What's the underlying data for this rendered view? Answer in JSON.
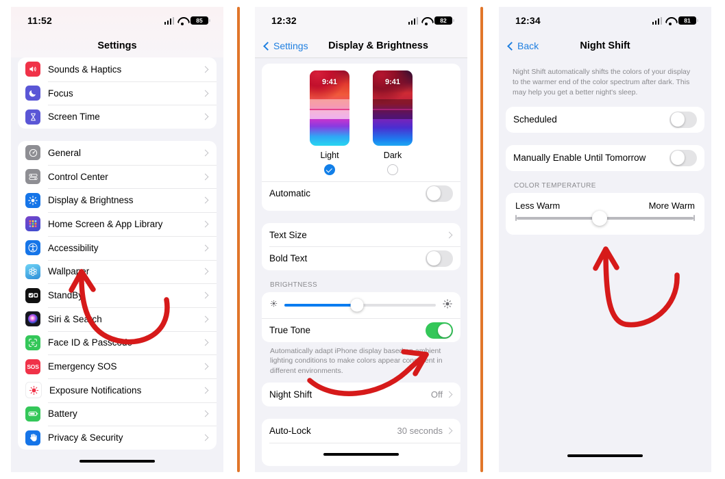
{
  "page": {
    "background": "#ffffff",
    "divider_color": "#e1762a"
  },
  "panels": [
    {
      "id": "settings-list",
      "status": {
        "time": "11:52",
        "battery": "85"
      },
      "nav": {
        "title": "Settings"
      },
      "groups": [
        {
          "rows": [
            {
              "label": "Sounds & Haptics",
              "icon": "speaker-icon",
              "icon_color": "#f03248",
              "accessory": "chevron"
            },
            {
              "label": "Focus",
              "icon": "moon-icon",
              "icon_color": "#5a56d6",
              "accessory": "chevron"
            },
            {
              "label": "Screen Time",
              "icon": "hourglass-icon",
              "icon_color": "#5a56d6",
              "accessory": "chevron"
            }
          ]
        },
        {
          "rows": [
            {
              "label": "General",
              "icon": "gear-icon",
              "icon_color": "#8e8e93",
              "accessory": "chevron"
            },
            {
              "label": "Control Center",
              "icon": "sliders-icon",
              "icon_color": "#8e8e93",
              "accessory": "chevron"
            },
            {
              "label": "Display & Brightness",
              "icon": "brightness-icon",
              "icon_color": "#1675e8",
              "accessory": "chevron"
            },
            {
              "label": "Home Screen & App Library",
              "icon": "app-grid-icon",
              "icon_color": "#5b3fb5",
              "accessory": "chevron"
            },
            {
              "label": "Accessibility",
              "icon": "accessibility-icon",
              "icon_color": "#1675e8",
              "accessory": "chevron"
            },
            {
              "label": "Wallpaper",
              "icon": "flower-icon",
              "icon_color": "#37b0e8",
              "accessory": "chevron"
            },
            {
              "label": "StandBy",
              "icon": "standby-icon",
              "icon_color": "#111111",
              "accessory": "chevron"
            },
            {
              "label": "Siri & Search",
              "icon": "siri-icon",
              "icon_color": "#1d1d2b",
              "accessory": "chevron"
            },
            {
              "label": "Face ID & Passcode",
              "icon": "faceid-icon",
              "icon_color": "#34c759",
              "accessory": "chevron"
            },
            {
              "label": "Emergency SOS",
              "icon": "sos-icon",
              "icon_color": "#f03248",
              "accessory": "chevron"
            },
            {
              "label": "Exposure Notifications",
              "icon": "exposure-icon",
              "icon_color": "#ffffff",
              "accessory": "chevron"
            },
            {
              "label": "Battery",
              "icon": "battery-icon",
              "icon_color": "#34c759",
              "accessory": "chevron"
            },
            {
              "label": "Privacy & Security",
              "icon": "hand-icon",
              "icon_color": "#1675e8",
              "accessory": "chevron"
            }
          ]
        }
      ]
    },
    {
      "id": "display-brightness",
      "status": {
        "time": "12:32",
        "battery": "82"
      },
      "nav": {
        "back_label": "Settings",
        "title": "Display & Brightness"
      },
      "appearance": {
        "options": [
          {
            "label": "Light",
            "selected": true,
            "wallpaper_time": "9:41"
          },
          {
            "label": "Dark",
            "selected": false,
            "wallpaper_time": "9:41"
          }
        ],
        "automatic": {
          "label": "Automatic",
          "on": false
        }
      },
      "text_group": [
        {
          "label": "Text Size",
          "accessory": "chevron"
        },
        {
          "label": "Bold Text",
          "accessory": "toggle",
          "on": false
        }
      ],
      "brightness": {
        "header": "BRIGHTNESS",
        "slider_percent": 48,
        "low_icon": "sun-small-icon",
        "high_icon": "sun-large-icon",
        "true_tone": {
          "label": "True Tone",
          "on": true
        },
        "footnote": "Automatically adapt iPhone display based on ambient lighting conditions to make colors appear consistent in different environments."
      },
      "night_shift": {
        "label": "Night Shift",
        "value": "Off",
        "accessory": "chevron"
      },
      "auto_lock": {
        "label": "Auto-Lock",
        "value": "30 seconds",
        "accessory": "chevron"
      }
    },
    {
      "id": "night-shift",
      "status": {
        "time": "12:34",
        "battery": "81"
      },
      "nav": {
        "back_label": "Back",
        "title": "Night Shift"
      },
      "description": "Night Shift automatically shifts the colors of your display to the warmer end of the color spectrum after dark. This may help you get a better night's sleep.",
      "scheduled": {
        "label": "Scheduled",
        "on": false
      },
      "manual": {
        "label": "Manually Enable Until Tomorrow",
        "on": false
      },
      "color_temperature": {
        "header": "COLOR TEMPERATURE",
        "left_label": "Less Warm",
        "right_label": "More Warm",
        "slider_percent": 47
      }
    }
  ]
}
